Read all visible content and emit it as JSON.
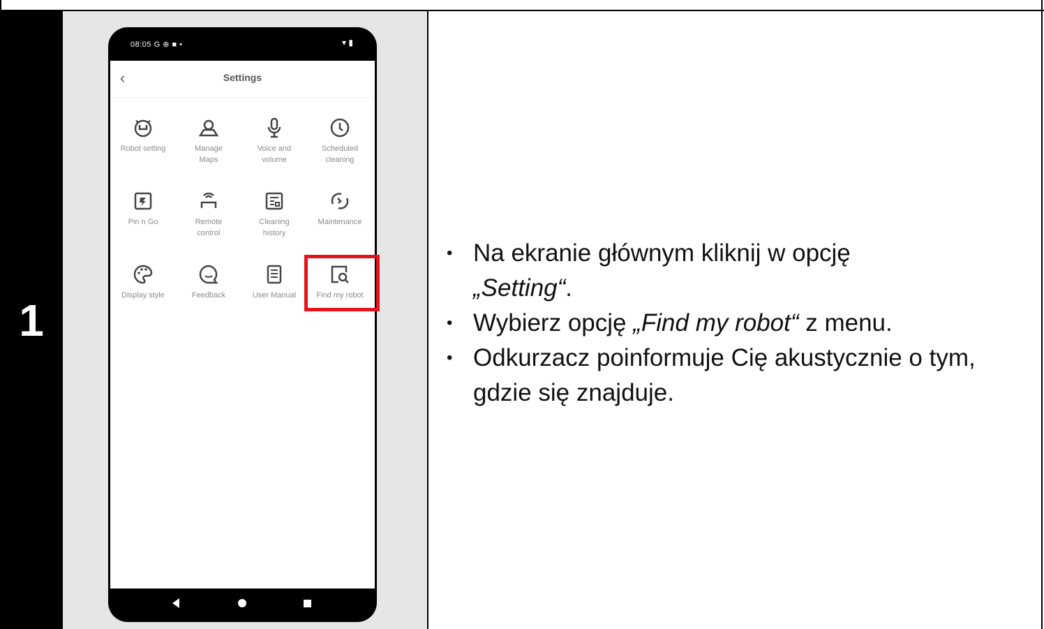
{
  "step": {
    "number": "1"
  },
  "phone": {
    "status_time": "08:05",
    "status_icons_left": "G ⊕ ■ •",
    "status_icons_right": "▾ ▮",
    "screen_title": "Settings",
    "tiles": [
      {
        "label": "Robot setting",
        "icon": "alarm-clock-icon"
      },
      {
        "label": "Manage\nMaps",
        "icon": "map-pin-icon"
      },
      {
        "label": "Voice and\nvolume",
        "icon": "microphone-icon"
      },
      {
        "label": "Scheduled\ncleaning",
        "icon": "clock-icon"
      },
      {
        "label": "Pin n Go",
        "icon": "pin-box-icon"
      },
      {
        "label": "Remote\ncontrol",
        "icon": "remote-icon"
      },
      {
        "label": "Cleaning\nhistory",
        "icon": "history-icon"
      },
      {
        "label": "Maintenance",
        "icon": "maintenance-icon"
      },
      {
        "label": "Display style",
        "icon": "palette-icon"
      },
      {
        "label": "Feedback",
        "icon": "chat-icon"
      },
      {
        "label": "User Manual",
        "icon": "manual-icon"
      },
      {
        "label": "Find my robot",
        "icon": "find-robot-icon"
      }
    ]
  },
  "instructions": {
    "b1_text": "Na ekranie głównym kliknij w opcję",
    "b1_italic": "„Setting“",
    "b1_end": ".",
    "b2_text": "Wybierz opcję",
    "b2_italic": "„Find my robot“",
    "b2_end": "z menu.",
    "b3_text": "Odkurzacz poinformuje Cię akustycznie o tym, gdzie się znajduje.",
    "bullet_char": "•"
  },
  "colors": {
    "highlight": "#e4141b"
  }
}
